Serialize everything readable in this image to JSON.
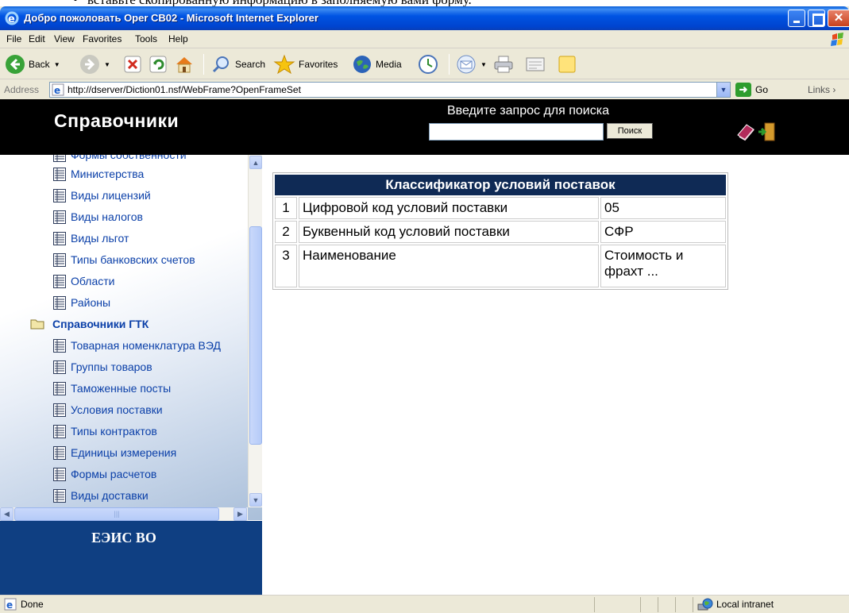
{
  "document_text": "вставьте скопированную информацию  в заполняемую вами форму.",
  "window": {
    "title": "Добро пожоловать Oper CB02 - Microsoft Internet Explorer"
  },
  "menu": [
    "File",
    "Edit",
    "View",
    "Favorites",
    "Tools",
    "Help"
  ],
  "toolbar": {
    "back": "Back",
    "search": "Search",
    "favorites": "Favorites",
    "media": "Media"
  },
  "address": {
    "label": "Address",
    "url": "http://dserver/Diction01.nsf/WebFrame?OpenFrameSet",
    "go": "Go",
    "links": "Links"
  },
  "header": {
    "site_title": "Справочники",
    "search_prompt": "Введите запрос для поиска",
    "search_button": "Поиск",
    "search_value": ""
  },
  "nav": {
    "items_top": [
      "Формы собственности",
      "Министерства",
      "Виды лицензий",
      "Виды налогов",
      "Виды льгот",
      "Типы банковских счетов",
      "Области",
      "Районы"
    ],
    "folder": "Справочники ГТК",
    "items_bottom": [
      "Товарная номенклатура ВЭД",
      "Группы товаров",
      "Таможенные посты",
      "Условия поставки",
      "Типы контрактов",
      "Единицы измерения",
      "Формы расчетов",
      "Виды доставки"
    ],
    "footer": "ЕЭИС ВО"
  },
  "classifier": {
    "title": "Классификатор условий поставок",
    "rows": [
      {
        "num": "1",
        "field": "Цифровой код условий поставки",
        "value": "05"
      },
      {
        "num": "2",
        "field": "Буквенный код условий поставки",
        "value": "СФР"
      },
      {
        "num": "3",
        "field": "Наименование",
        "value": "Стоимость и фрахт ..."
      }
    ]
  },
  "status": {
    "text": "Done",
    "zone": "Local intranet"
  },
  "colors": {
    "titlebar": "#0054e3",
    "header_bg": "#000000",
    "table_header": "#0f2a55",
    "nav_link": "#0a3fa8",
    "footer_band": "#0f3f82"
  }
}
